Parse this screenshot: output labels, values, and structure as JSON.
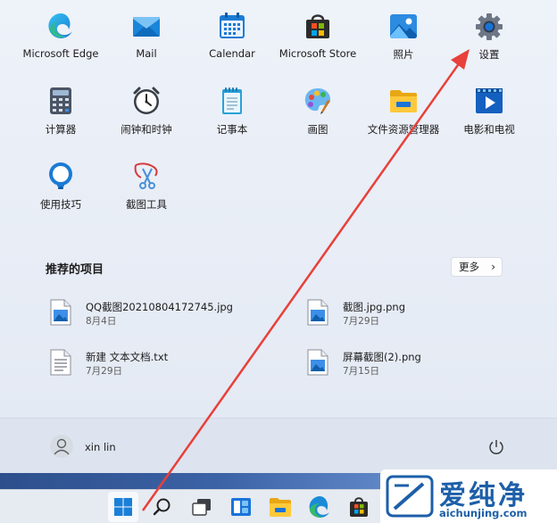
{
  "pinned_apps": [
    {
      "label": "Microsoft Edge",
      "icon": "edge-icon"
    },
    {
      "label": "Mail",
      "icon": "mail-icon"
    },
    {
      "label": "Calendar",
      "icon": "calendar-icon"
    },
    {
      "label": "Microsoft Store",
      "icon": "store-icon"
    },
    {
      "label": "照片",
      "icon": "photos-icon"
    },
    {
      "label": "设置",
      "icon": "settings-gear-icon"
    },
    {
      "label": "计算器",
      "icon": "calculator-icon"
    },
    {
      "label": "闹钟和时钟",
      "icon": "alarm-clock-icon"
    },
    {
      "label": "记事本",
      "icon": "notepad-icon"
    },
    {
      "label": "画图",
      "icon": "paint-icon"
    },
    {
      "label": "文件资源管理器",
      "icon": "file-explorer-icon"
    },
    {
      "label": "电影和电视",
      "icon": "movies-tv-icon"
    },
    {
      "label": "使用技巧",
      "icon": "tips-bulb-icon"
    },
    {
      "label": "截图工具",
      "icon": "snipping-tool-icon"
    }
  ],
  "recommended": {
    "title": "推荐的项目",
    "more_label": "更多",
    "items": [
      {
        "name": "QQ截图20210804172745.jpg",
        "date": "8月4日",
        "icon": "image-file-icon"
      },
      {
        "name": "截图.jpg.png",
        "date": "7月29日",
        "icon": "image-file-icon"
      },
      {
        "name": "新建 文本文档.txt",
        "date": "7月29日",
        "icon": "text-file-icon"
      },
      {
        "name": "屏幕截图(2).png",
        "date": "7月15日",
        "icon": "image-file-icon"
      }
    ]
  },
  "user": {
    "name": "xin lin"
  },
  "taskbar": {
    "items": [
      "start-icon",
      "search-icon",
      "task-view-icon",
      "widgets-icon",
      "file-explorer-icon",
      "edge-icon",
      "store-icon"
    ]
  },
  "watermark": {
    "text": "爱纯净",
    "url": "aichunjing.com"
  },
  "colors": {
    "accent": "#0067c0",
    "arrow": "#e8403a",
    "watermark": "#1d5fa8"
  }
}
